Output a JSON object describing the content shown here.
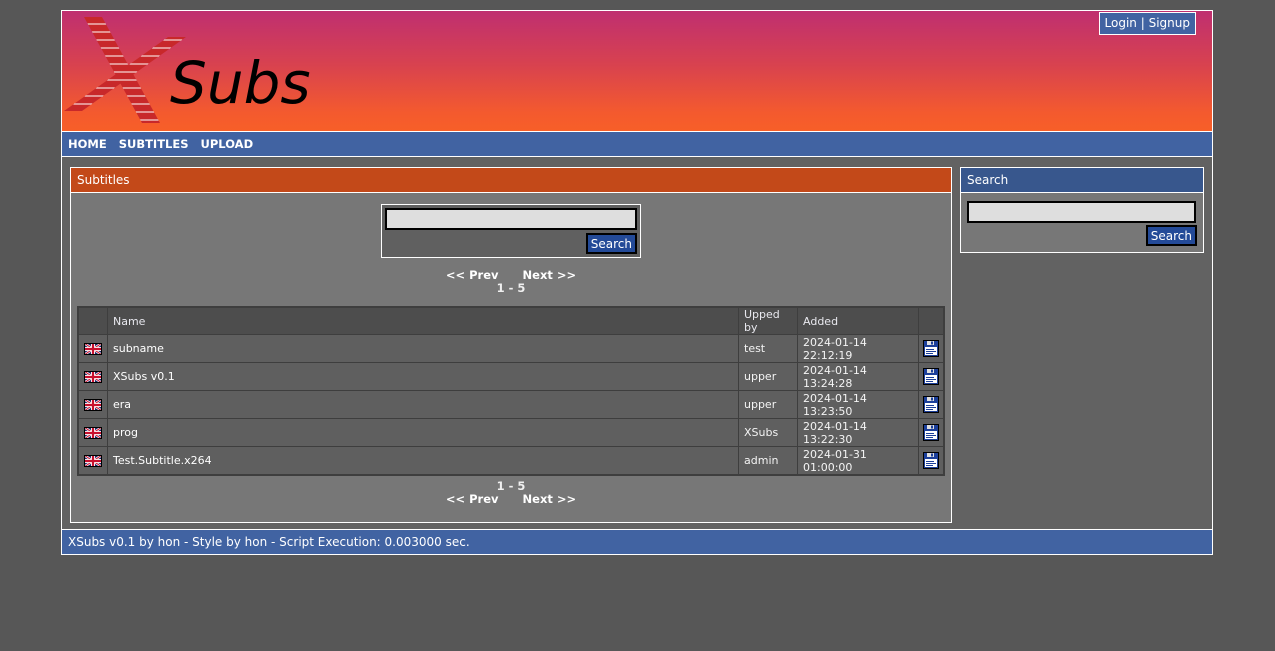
{
  "site": {
    "logo_text": "Subs",
    "logo_mark": "X"
  },
  "account": {
    "login_label": "Login",
    "separator": "|",
    "signup_label": "Signup"
  },
  "nav": {
    "items": [
      {
        "label": "HOME"
      },
      {
        "label": "SUBTITLES"
      },
      {
        "label": "UPLOAD"
      }
    ]
  },
  "main_panel": {
    "title": "Subtitles",
    "search": {
      "value": "",
      "placeholder": "",
      "button_label": "Search"
    },
    "pager": {
      "prev_label": "<< Prev",
      "next_label": "Next >>",
      "range": "1 - 5"
    },
    "table": {
      "columns": [
        "",
        "Name",
        "Upped by",
        "Added",
        ""
      ],
      "rows": [
        {
          "language": "uk-flag",
          "name": "subname",
          "upped_by": "test",
          "added": "2024-01-14 22:12:19",
          "action": "download-icon"
        },
        {
          "language": "uk-flag",
          "name": "XSubs v0.1",
          "upped_by": "upper",
          "added": "2024-01-14 13:24:28",
          "action": "download-icon"
        },
        {
          "language": "uk-flag",
          "name": "era",
          "upped_by": "upper",
          "added": "2024-01-14 13:23:50",
          "action": "download-icon"
        },
        {
          "language": "uk-flag",
          "name": "prog",
          "upped_by": "XSubs",
          "added": "2024-01-14 13:22:30",
          "action": "download-icon"
        },
        {
          "language": "uk-flag",
          "name": "Test.Subtitle.x264",
          "upped_by": "admin",
          "added": "2024-01-31 01:00:00",
          "action": "download-icon"
        }
      ]
    }
  },
  "side_panel": {
    "title": "Search",
    "search": {
      "value": "",
      "placeholder": "",
      "button_label": "Search"
    }
  },
  "footer": {
    "text": "XSubs v0.1 by hon - Style by hon - Script Execution: 0.003000 sec."
  },
  "colors": {
    "nav_blue": "#4163a2",
    "panel_header_orange": "#c34919",
    "side_header_blue": "#38578d",
    "button_blue": "#234a98",
    "header_gradient_top": "#bf2f70",
    "header_gradient_bottom": "#f75f28"
  }
}
